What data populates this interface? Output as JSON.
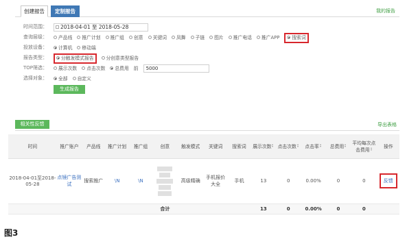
{
  "tabs": {
    "create": "创建报告",
    "custom": "定制报告",
    "my_reports": "我的报告"
  },
  "form": {
    "time_label": "时间范围：",
    "date_value": "2018-04-01 至 2018-05-28",
    "level_label": "查询层级：",
    "levels": [
      "产品线",
      "推广计划",
      "推广组",
      "创意",
      "关键词",
      "凤舞",
      "子链",
      "图片",
      "推广电话",
      "推广APP",
      "搜索词"
    ],
    "device_label": "投放设备：",
    "devices": [
      "计算机",
      "移动端"
    ],
    "type_label": "报告类型：",
    "types": [
      "分触发模式报告",
      "分创意类型报告"
    ],
    "top_label": "TOP筛选：",
    "top_options": [
      "展示次数",
      "点击次数",
      "总费用"
    ],
    "top_prefix": "前",
    "top_value": "5000",
    "object_label": "选择对象：",
    "objects": [
      "全部",
      "自定义"
    ],
    "generate": "生成报告"
  },
  "panel": {
    "related": "相关性反馈",
    "export": "导出表格"
  },
  "table": {
    "headers": [
      "时间",
      "推广账户",
      "产品线",
      "推广计划",
      "推广组",
      "创意",
      "触发模式",
      "关键词",
      "搜索词",
      "展示次数",
      "点击次数",
      "点击率",
      "总费用",
      "平均每次点击费用",
      "操作"
    ],
    "row": {
      "time": "2018-04-01至2018-05-28",
      "account": "点镜广告测试",
      "product": "搜索推广",
      "plan": "\\N",
      "group": "\\N",
      "mode": "高级精确",
      "keyword": "手机报价大全",
      "search_term": "手机",
      "impressions": "13",
      "clicks": "0",
      "ctr": "0.00%",
      "cost": "0",
      "avg_cpc": "0",
      "action": "反馈"
    },
    "total": {
      "label": "合计",
      "impressions": "13",
      "clicks": "0",
      "ctr": "0.00%",
      "cost": "0",
      "avg_cpc": "0"
    }
  },
  "caption": "图3",
  "colors": {
    "accent_blue": "#3f78b5",
    "accent_green": "#5cb85c",
    "highlight_red": "#d7262c"
  }
}
